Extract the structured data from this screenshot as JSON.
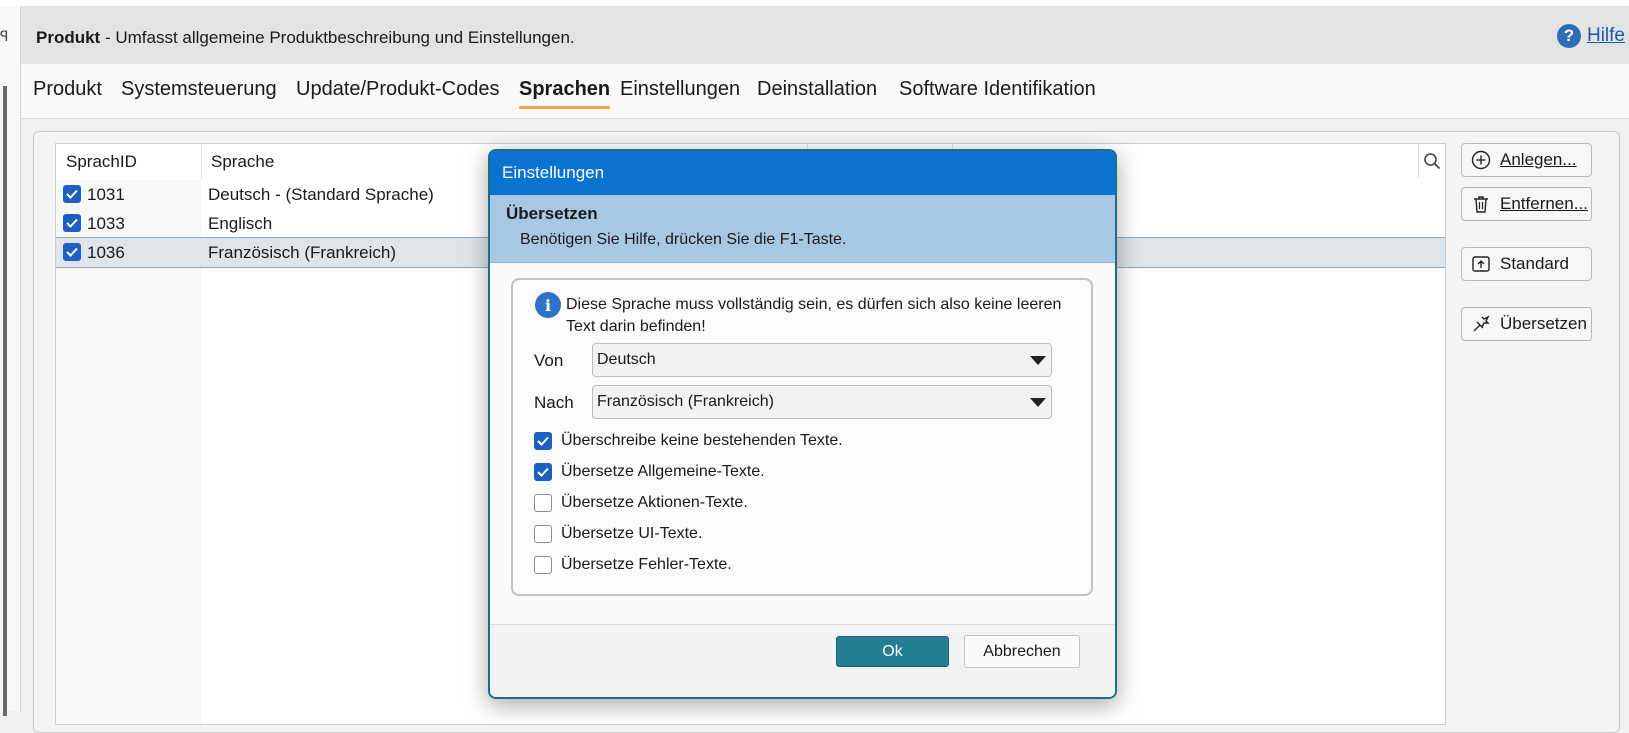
{
  "header": {
    "title_bold": "Produkt",
    "title_rest": " - Umfasst allgemeine Produktbeschreibung und Einstellungen.",
    "help_label": "Hilfe"
  },
  "tabs": [
    {
      "label": "Produkt",
      "active": false
    },
    {
      "label": "Systemsteuerung",
      "active": false
    },
    {
      "label": "Update/Produkt-Codes",
      "active": false
    },
    {
      "label": "Sprachen",
      "active": true
    },
    {
      "label": "Einstellungen",
      "active": false
    },
    {
      "label": "Deinstallation",
      "active": false
    },
    {
      "label": "Software Identifikation",
      "active": false
    }
  ],
  "grid": {
    "columns": [
      "SprachID",
      "Sprache"
    ],
    "rows": [
      {
        "checked": true,
        "id": "1031",
        "language": "Deutsch - (Standard Sprache)",
        "selected": false
      },
      {
        "checked": true,
        "id": "1033",
        "language": "Englisch",
        "selected": false
      },
      {
        "checked": true,
        "id": "1036",
        "language": "Französisch (Frankreich)",
        "selected": true
      }
    ]
  },
  "side_buttons": {
    "create_label": "Anlegen...",
    "remove_label": "Entfernen...",
    "standard_label": "Standard",
    "translate_label": "Übersetzen"
  },
  "dialog": {
    "title": "Einstellungen",
    "heading": "Übersetzen",
    "subtitle": "Benötigen Sie Hilfe, drücken Sie die F1-Taste.",
    "info_text": "Diese Sprache muss vollständig sein, es dürfen sich also keine leeren Text darin befinden!",
    "from_label": "Von",
    "from_value": "Deutsch",
    "to_label": "Nach",
    "to_value": "Französisch (Frankreich)",
    "options": [
      {
        "label": "Überschreibe keine bestehenden Texte.",
        "checked": true
      },
      {
        "label": "Übersetze Allgemeine-Texte.",
        "checked": true
      },
      {
        "label": "Übersetze Aktionen-Texte.",
        "checked": false
      },
      {
        "label": "Übersetze UI-Texte.",
        "checked": false
      },
      {
        "label": "Übersetze Fehler-Texte.",
        "checked": false
      }
    ],
    "ok_label": "Ok",
    "cancel_label": "Abbrechen"
  },
  "colors": {
    "title_bar": "#0a73cf",
    "banner": "#a7c8e5",
    "ok_button": "#237e93",
    "checkbox": "#1f5fbf",
    "tab_underline": "#f0a24d"
  },
  "icons": {
    "help": "help-circle-icon",
    "search": "search-icon",
    "create": "plus-circle-icon",
    "remove": "trash-icon",
    "standard": "upload-box-icon",
    "translate": "translate-icon",
    "info": "info-icon",
    "dropdown": "caret-down-icon"
  }
}
